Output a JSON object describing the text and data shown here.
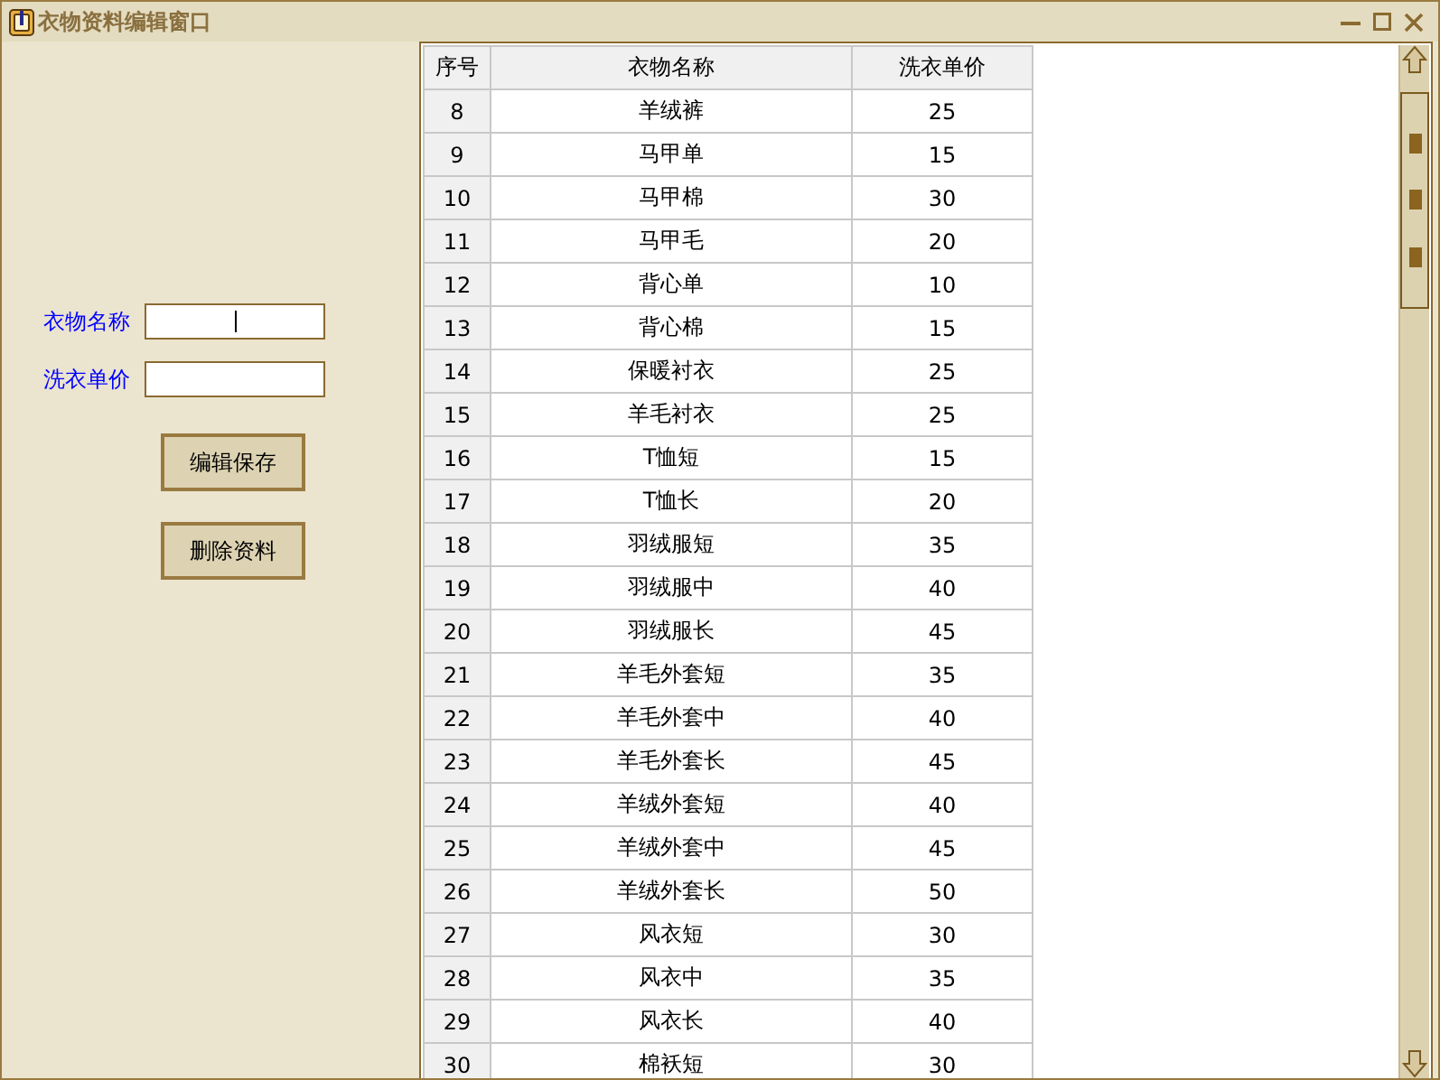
{
  "window": {
    "title": "衣物资料编辑窗口"
  },
  "form": {
    "fields": [
      {
        "label": "衣物名称",
        "focused": true
      },
      {
        "label": "洗衣单价",
        "focused": false
      }
    ],
    "buttons": [
      "编辑保存",
      "删除资料"
    ]
  },
  "table": {
    "columns": [
      "序号",
      "衣物名称",
      "洗衣单价"
    ],
    "rows": [
      [
        "8",
        "羊绒裤",
        "25"
      ],
      [
        "9",
        "马甲单",
        "15"
      ],
      [
        "10",
        "马甲棉",
        "30"
      ],
      [
        "11",
        "马甲毛",
        "20"
      ],
      [
        "12",
        "背心单",
        "10"
      ],
      [
        "13",
        "背心棉",
        "15"
      ],
      [
        "14",
        "保暖衬衣",
        "25"
      ],
      [
        "15",
        "羊毛衬衣",
        "25"
      ],
      [
        "16",
        "T恤短",
        "15"
      ],
      [
        "17",
        "T恤长",
        "20"
      ],
      [
        "18",
        "羽绒服短",
        "35"
      ],
      [
        "19",
        "羽绒服中",
        "40"
      ],
      [
        "20",
        "羽绒服长",
        "45"
      ],
      [
        "21",
        "羊毛外套短",
        "35"
      ],
      [
        "22",
        "羊毛外套中",
        "40"
      ],
      [
        "23",
        "羊毛外套长",
        "45"
      ],
      [
        "24",
        "羊绒外套短",
        "40"
      ],
      [
        "25",
        "羊绒外套中",
        "45"
      ],
      [
        "26",
        "羊绒外套长",
        "50"
      ],
      [
        "27",
        "风衣短",
        "30"
      ],
      [
        "28",
        "风衣中",
        "35"
      ],
      [
        "29",
        "风衣长",
        "40"
      ],
      [
        "30",
        "棉袄短",
        "30"
      ]
    ]
  }
}
